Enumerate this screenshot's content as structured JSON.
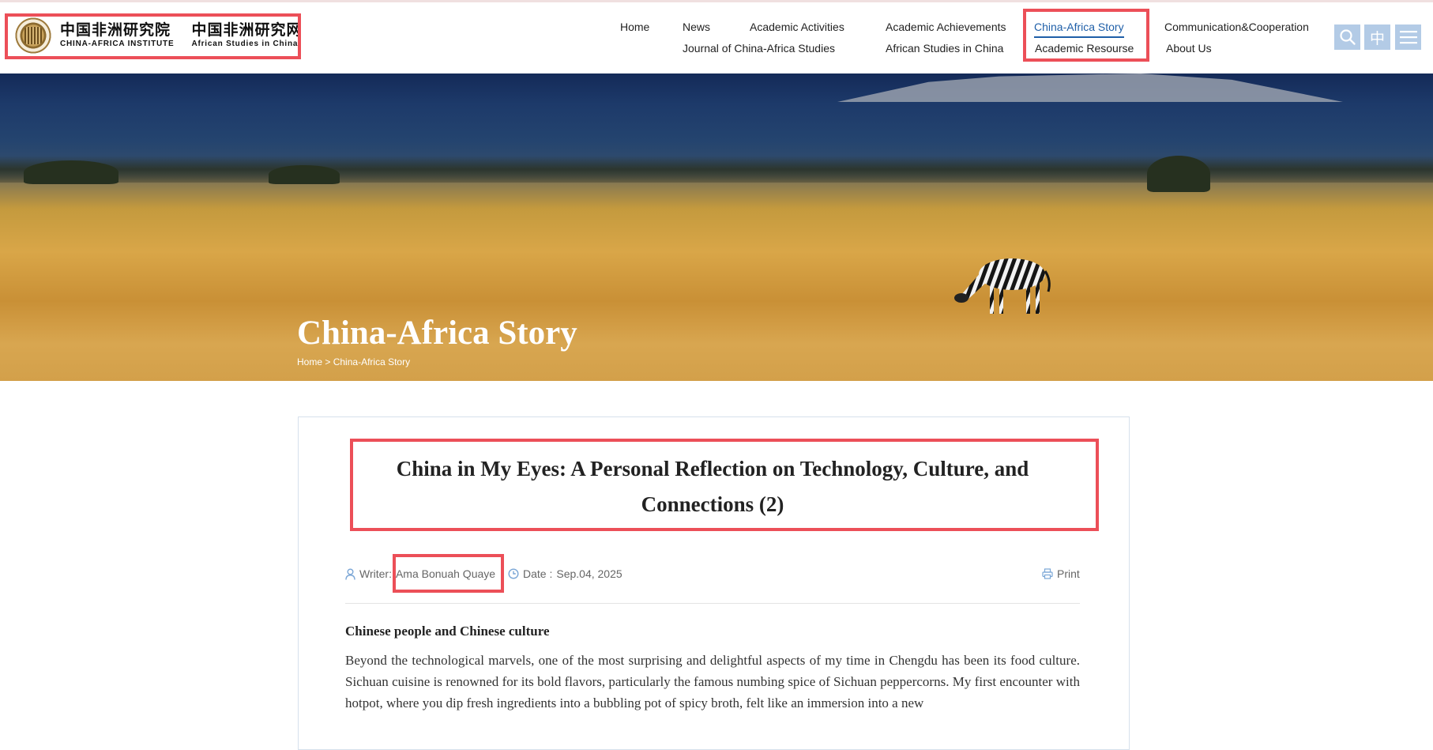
{
  "logo": {
    "primary_cn": "中国非洲研究院",
    "primary_en": "CHINA-AFRICA INSTITUTE",
    "secondary_cn": "中国非洲研究网",
    "secondary_en": "African Studies in China"
  },
  "nav": {
    "items": [
      {
        "label": "Home"
      },
      {
        "label": "News"
      },
      {
        "label": "Academic Activities"
      },
      {
        "label": "Academic Achievements"
      },
      {
        "label": "China-Africa Story"
      },
      {
        "label": "Communication&Cooperation"
      },
      {
        "label": "Journal of China-Africa Studies"
      },
      {
        "label": "African Studies in China"
      },
      {
        "label": "Academic Resourse"
      },
      {
        "label": "About Us"
      }
    ],
    "active": "China-Africa Story",
    "lang_toggle": "中"
  },
  "banner": {
    "title": "China-Africa Story",
    "breadcrumb": {
      "home": "Home",
      "separator": ">",
      "current": "China-Africa Story"
    }
  },
  "article": {
    "title": "China in My Eyes: A Personal Reflection on Technology, Culture, and Connections (2)",
    "writer_label": "Writer:",
    "writer": "Ama Bonuah Quaye",
    "date_label": "Date :",
    "date": "Sep.04, 2025",
    "print_label": "Print",
    "section_heading": "Chinese people and Chinese culture",
    "body": "Beyond the technological marvels, one of the most surprising and delightful aspects of my time in Chengdu has been its food culture. Sichuan cuisine is renowned for its bold flavors, particularly the famous numbing spice of Sichuan peppercorns. My first encounter with hotpot, where you dip fresh ingredients into a bubbling pot of spicy broth, felt like an immersion into a new"
  },
  "colors": {
    "accent": "#1f5fa8",
    "icon_bg": "#b3cbe6",
    "highlight": "#ec4f58"
  }
}
